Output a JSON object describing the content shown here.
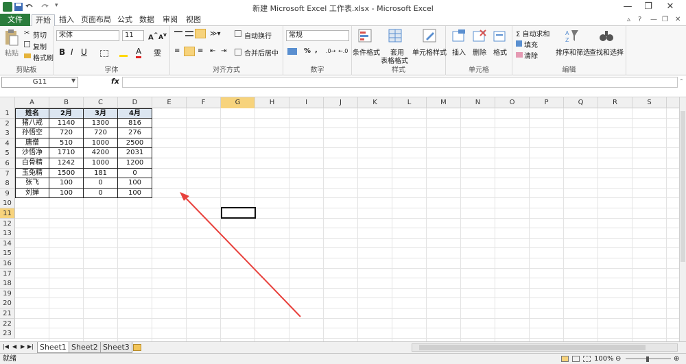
{
  "window": {
    "title": "新建 Microsoft Excel 工作表.xlsx - Microsoft Excel",
    "minimize": "—",
    "restore": "❐",
    "close": "✕"
  },
  "tabs": [
    "文件",
    "开始",
    "插入",
    "页面布局",
    "公式",
    "数据",
    "审阅",
    "视图"
  ],
  "ribbon": {
    "clipboard": {
      "paste": "粘贴",
      "cut": "剪切",
      "copy": "复制",
      "format_painter": "格式刷",
      "label": "剪贴板"
    },
    "font": {
      "name": "宋体",
      "size": "11",
      "bold": "B",
      "italic": "I",
      "underline": "U",
      "label": "字体"
    },
    "alignment": {
      "wrap": "自动换行",
      "merge": "合并后居中",
      "label": "对齐方式"
    },
    "number": {
      "format": "常规",
      "percent": "%",
      "comma": ",",
      "label": "数字"
    },
    "styles": {
      "conditional": "条件格式",
      "table_line1": "套用",
      "table_line2": "表格格式",
      "cell_styles": "单元格样式",
      "label": "样式"
    },
    "cells": {
      "insert": "插入",
      "delete": "删除",
      "format": "格式",
      "label": "单元格"
    },
    "editing": {
      "autosum": "Σ 自动求和",
      "fill": "填充",
      "clear": "清除",
      "sort": "排序和筛选",
      "find": "查找和选择",
      "label": "编辑"
    }
  },
  "formula_bar": {
    "name_box": "G11",
    "fx": "fx",
    "value": ""
  },
  "columns": [
    "A",
    "B",
    "C",
    "D",
    "E",
    "F",
    "G",
    "H",
    "I",
    "J",
    "K",
    "L",
    "M",
    "N",
    "O",
    "P",
    "Q",
    "R",
    "S"
  ],
  "rows": [
    "1",
    "2",
    "3",
    "4",
    "5",
    "6",
    "7",
    "8",
    "9",
    "10",
    "11",
    "12",
    "13",
    "14",
    "15",
    "16",
    "17",
    "18",
    "19",
    "20",
    "21",
    "22",
    "23"
  ],
  "table": {
    "header": [
      "姓名",
      "2月",
      "3月",
      "4月"
    ],
    "rows": [
      [
        "猪八戒",
        "1140",
        "1300",
        "816"
      ],
      [
        "孙悟空",
        "720",
        "720",
        "276"
      ],
      [
        "唐僧",
        "510",
        "1000",
        "2500"
      ],
      [
        "沙悟净",
        "1710",
        "4200",
        "2031"
      ],
      [
        "白骨精",
        "1242",
        "1000",
        "1200"
      ],
      [
        "玉兔精",
        "1500",
        "181",
        "0"
      ],
      [
        "张飞",
        "100",
        "0",
        "100"
      ],
      [
        "刘婵",
        "100",
        "0",
        "100"
      ]
    ]
  },
  "selected_cell": "G11",
  "sheets": [
    "Sheet1",
    "Sheet2",
    "Sheet3"
  ],
  "status": {
    "ready": "就绪",
    "zoom": "100%"
  },
  "colors": {
    "file_tab": "#2a7c3c",
    "header_fill": "#dce6f1",
    "selected_header": "#f7d37c",
    "arrow": "#e8413c"
  }
}
